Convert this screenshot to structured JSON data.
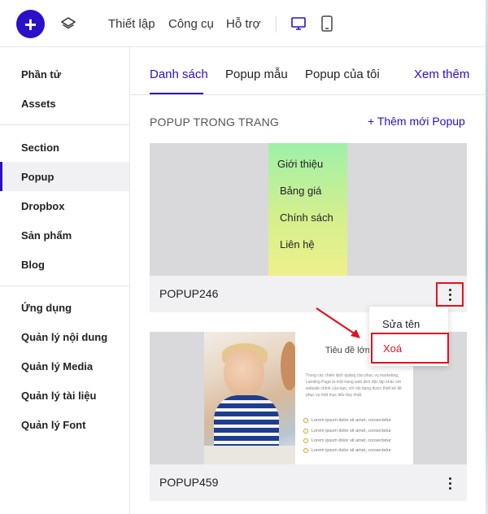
{
  "toolbar": {
    "add_label": "+",
    "menu": [
      "Thiết lập",
      "Công cụ",
      "Hỗ trợ"
    ]
  },
  "sidebar": {
    "items": [
      "Phần tử",
      "Assets",
      "Section",
      "Popup",
      "Dropbox",
      "Sản phẩm",
      "Blog",
      "Ứng dụng",
      "Quản lý nội dung",
      "Quản lý Media",
      "Quản lý tài liệu",
      "Quản lý Font"
    ],
    "active": "Popup"
  },
  "tabs": {
    "items": [
      "Danh sách",
      "Popup mẫu",
      "Popup của tôi"
    ],
    "see_more": "Xem thêm"
  },
  "section": {
    "title": "POPUP TRONG TRANG",
    "add_label": "+ Thêm mới Popup"
  },
  "popups": [
    {
      "name": "POPUP246",
      "preview_menu": [
        "Giới thiệu",
        "Bảng giá",
        "Chính sách",
        "Liên hệ"
      ]
    },
    {
      "name": "POPUP459",
      "preview_title": "Tiêu đề lớn nội dung",
      "preview_body": "Trong các chiến dịch quảng cáo phục vụ marketing, Landing Page là một trang web đơn độc lập khác với website chính của bạn, với nội dung được thiết kế để phục vụ một mục tiêu duy nhất",
      "preview_list": [
        "Lorem ipsum dolor sit amet, consectetur",
        "Lorem ipsum dolor sit amet, consectetur",
        "Lorem ipsum dolor sit amet, consectetur",
        "Lorem ipsum dolor sit amet, consectetur"
      ]
    }
  ],
  "context_menu": {
    "rename": "Sửa tên",
    "delete": "Xoá"
  },
  "colors": {
    "accent": "#2a10c9",
    "highlight": "#e4121e"
  }
}
